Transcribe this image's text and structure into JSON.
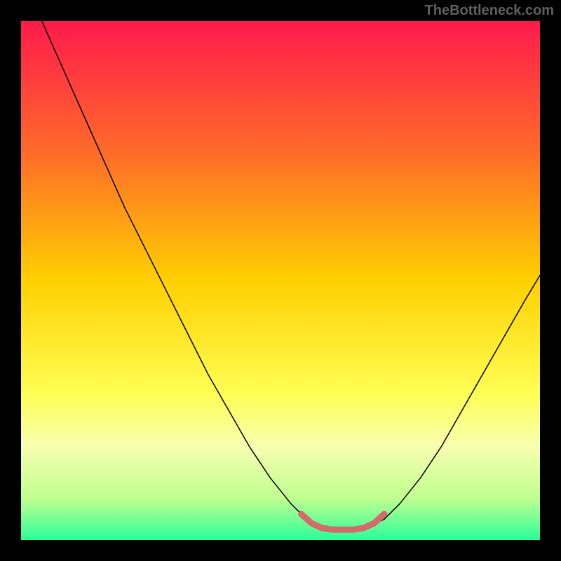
{
  "attribution": "TheBottleneck.com",
  "chart_data": {
    "type": "line",
    "title": "",
    "xlabel": "",
    "ylabel": "",
    "xlim": [
      0,
      100
    ],
    "ylim": [
      0,
      100
    ],
    "grid": false,
    "legend": false,
    "background_gradient": {
      "type": "linear-vertical",
      "stops": [
        {
          "offset": 0,
          "color": "#ff1a4c"
        },
        {
          "offset": 0.25,
          "color": "#ff6a2a"
        },
        {
          "offset": 0.5,
          "color": "#ffd000"
        },
        {
          "offset": 0.72,
          "color": "#ffff55"
        },
        {
          "offset": 0.82,
          "color": "#f7ffb0"
        },
        {
          "offset": 0.92,
          "color": "#c0ff90"
        },
        {
          "offset": 1.0,
          "color": "#2aff9a"
        }
      ]
    },
    "series": [
      {
        "name": "curve",
        "type": "line",
        "color": "#000000",
        "width": 1.5,
        "points": [
          {
            "x": 4,
            "y": 100
          },
          {
            "x": 8,
            "y": 91
          },
          {
            "x": 12,
            "y": 82
          },
          {
            "x": 16,
            "y": 73
          },
          {
            "x": 20,
            "y": 64
          },
          {
            "x": 24,
            "y": 56
          },
          {
            "x": 28,
            "y": 48
          },
          {
            "x": 32,
            "y": 40
          },
          {
            "x": 36,
            "y": 32
          },
          {
            "x": 40,
            "y": 25
          },
          {
            "x": 44,
            "y": 18
          },
          {
            "x": 48,
            "y": 12
          },
          {
            "x": 52,
            "y": 7
          },
          {
            "x": 55,
            "y": 4
          },
          {
            "x": 58,
            "y": 2.5
          },
          {
            "x": 61,
            "y": 2
          },
          {
            "x": 64,
            "y": 2
          },
          {
            "x": 67,
            "y": 2.5
          },
          {
            "x": 70,
            "y": 4
          },
          {
            "x": 73,
            "y": 7
          },
          {
            "x": 77,
            "y": 12
          },
          {
            "x": 81,
            "y": 18
          },
          {
            "x": 85,
            "y": 25
          },
          {
            "x": 89,
            "y": 32
          },
          {
            "x": 93,
            "y": 39
          },
          {
            "x": 97,
            "y": 46
          },
          {
            "x": 100,
            "y": 51
          }
        ]
      },
      {
        "name": "highlight-bottom",
        "type": "line",
        "color": "#d46a6a",
        "width": 9,
        "points": [
          {
            "x": 54,
            "y": 5
          },
          {
            "x": 56,
            "y": 3.2
          },
          {
            "x": 58,
            "y": 2.3
          },
          {
            "x": 60,
            "y": 2
          },
          {
            "x": 62,
            "y": 2
          },
          {
            "x": 64,
            "y": 2
          },
          {
            "x": 66,
            "y": 2.3
          },
          {
            "x": 68,
            "y": 3.2
          },
          {
            "x": 70,
            "y": 5
          }
        ]
      }
    ]
  }
}
